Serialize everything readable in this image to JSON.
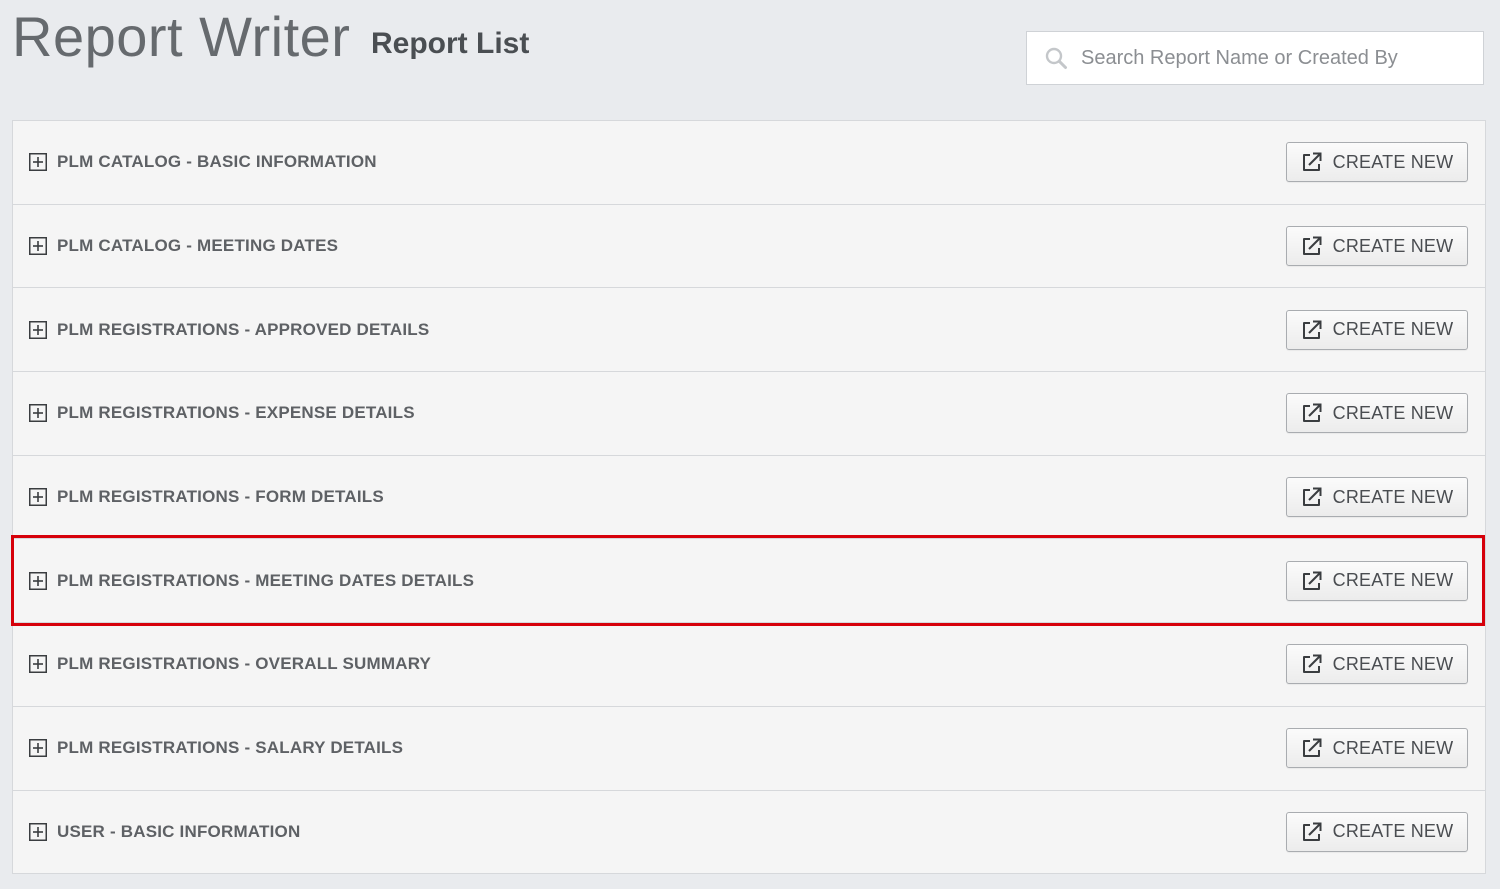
{
  "header": {
    "app_title": "Report Writer",
    "page_title": "Report List"
  },
  "search": {
    "placeholder": "Search Report Name or Created By",
    "value": ""
  },
  "reports": [
    {
      "name": "PLM CATALOG - BASIC INFORMATION",
      "button_label": "CREATE NEW"
    },
    {
      "name": "PLM CATALOG - MEETING DATES",
      "button_label": "CREATE NEW"
    },
    {
      "name": "PLM REGISTRATIONS - APPROVED DETAILS",
      "button_label": "CREATE NEW"
    },
    {
      "name": "PLM REGISTRATIONS - EXPENSE DETAILS",
      "button_label": "CREATE NEW"
    },
    {
      "name": "PLM REGISTRATIONS - FORM DETAILS",
      "button_label": "CREATE NEW"
    },
    {
      "name": "PLM REGISTRATIONS - MEETING DATES DETAILS",
      "button_label": "CREATE NEW",
      "highlighted": true
    },
    {
      "name": "PLM REGISTRATIONS - OVERALL SUMMARY",
      "button_label": "CREATE NEW"
    },
    {
      "name": "PLM REGISTRATIONS - SALARY DETAILS",
      "button_label": "CREATE NEW"
    },
    {
      "name": "USER - BASIC INFORMATION",
      "button_label": "CREATE NEW"
    }
  ],
  "icons": {
    "search": "search-icon",
    "expand": "plus-square-icon",
    "create": "external-link-icon"
  },
  "colors": {
    "highlight": "#d6000a",
    "background": "#e9ebee",
    "row_background": "#f5f5f5"
  }
}
